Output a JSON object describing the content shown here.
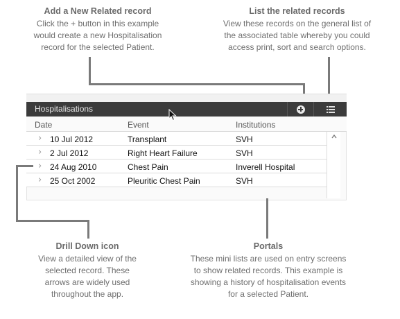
{
  "callouts": {
    "add": {
      "title": "Add a New Related record",
      "line1": "Click the + button in this example",
      "line2": "would create a new Hospitalisation",
      "line3": "record for the selected Patient."
    },
    "list": {
      "title": "List the related records",
      "line1": "View these records on the general list of",
      "line2": "the associated table whereby you could",
      "line3": "access print, sort and search options."
    },
    "drill": {
      "title": "Drill Down icon",
      "line1": "View a detailed view of the",
      "line2": "selected record. These",
      "line3": "arrows are widely used",
      "line4": "throughout the app."
    },
    "portals": {
      "title": "Portals",
      "line1": "These mini lists are used on entry screens",
      "line2": "to show related records. This example is",
      "line3": "showing a history of hospitalisation events",
      "line4": "for a selected Patient."
    }
  },
  "portal": {
    "title": "Hospitalisations",
    "add_icon": "plus-circle-icon",
    "list_icon": "list-icon",
    "columns": [
      "Date",
      "Event",
      "Institutions"
    ],
    "rows": [
      {
        "date": "10 Jul 2012",
        "event": "Transplant",
        "institution": "SVH"
      },
      {
        "date": "2 Jul 2012",
        "event": "Right Heart Failure",
        "institution": "SVH"
      },
      {
        "date": "24 Aug 2010",
        "event": "Chest Pain",
        "institution": "Inverell Hospital"
      },
      {
        "date": "25 Oct 2002",
        "event": "Pleuritic Chest Pain",
        "institution": "SVH"
      }
    ],
    "drill_icon": "chevron-right-icon",
    "scroll_icon": "chevron-up-icon"
  }
}
